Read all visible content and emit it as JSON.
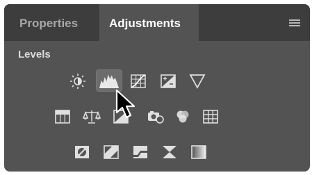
{
  "tabs": [
    {
      "label": "Properties",
      "active": false
    },
    {
      "label": "Adjustments",
      "active": true
    }
  ],
  "panel_menu_icon": "hamburger-icon",
  "section_title": "Levels",
  "icon_rows": [
    [
      "brightness-contrast-icon",
      "levels-icon",
      "curves-icon",
      "exposure-icon",
      "vibrance-icon"
    ],
    [
      "hue-saturation-icon",
      "color-balance-icon",
      "black-white-icon",
      "photo-filter-icon",
      "channel-mixer-icon",
      "color-lookup-icon"
    ],
    [
      "invert-icon",
      "posterize-icon",
      "threshold-icon",
      "selective-color-icon",
      "gradient-map-icon"
    ]
  ],
  "selected_icon": "levels-icon",
  "colors": {
    "panel": "#535353",
    "tabbar": "#3d3d3d",
    "icon": "#e0e0e0"
  }
}
